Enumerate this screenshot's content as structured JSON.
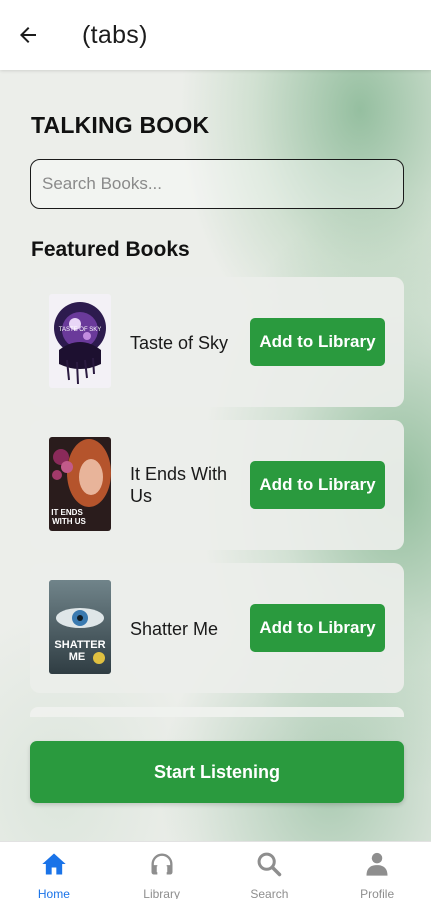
{
  "header": {
    "title": "(tabs)",
    "back_icon": "arrow-left-icon"
  },
  "main": {
    "app_title": "TALKING BOOK",
    "search": {
      "placeholder": "Search Books...",
      "value": ""
    },
    "featured_title": "Featured Books",
    "books": [
      {
        "title": "Taste of Sky",
        "cover_text": "TASTE OF SKY",
        "button_label": "Add to Library"
      },
      {
        "title": "It Ends With Us",
        "cover_text": "IT ENDS WITH US",
        "button_label": "Add to Library"
      },
      {
        "title": "Shatter Me",
        "cover_text": "SHATTER ME",
        "button_label": "Add to Library"
      }
    ],
    "start_button_label": "Start Listening"
  },
  "bottom_nav": {
    "items": [
      {
        "label": "Home",
        "icon": "home-icon",
        "active": true
      },
      {
        "label": "Library",
        "icon": "headphones-icon",
        "active": false
      },
      {
        "label": "Search",
        "icon": "search-icon",
        "active": false
      },
      {
        "label": "Profile",
        "icon": "person-icon",
        "active": false
      }
    ]
  },
  "colors": {
    "accent_green": "#2a9a3e",
    "active_nav": "#1a73e8",
    "inactive_nav": "#8e8e8e"
  }
}
